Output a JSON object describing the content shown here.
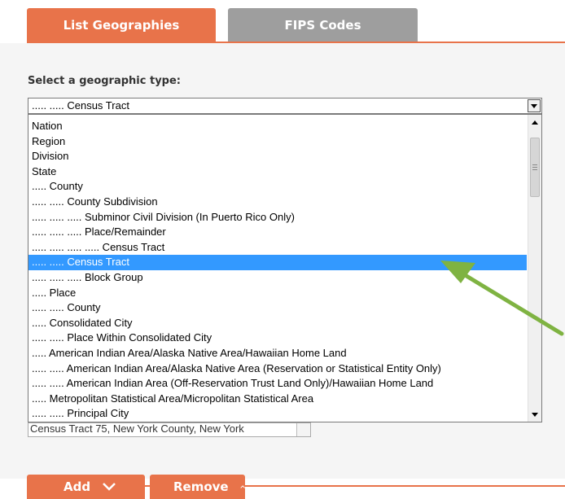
{
  "tabs": [
    {
      "label": "List Geographies",
      "active": true
    },
    {
      "label": "FIPS Codes",
      "active": false
    }
  ],
  "form": {
    "select_label": "Select a geographic type:",
    "selected_value": "..... ..... Census Tract",
    "options": [
      {
        "label": "Nation"
      },
      {
        "label": "Region"
      },
      {
        "label": "Division"
      },
      {
        "label": "State"
      },
      {
        "label": "..... County"
      },
      {
        "label": "..... ..... County Subdivision"
      },
      {
        "label": "..... ..... ..... Subminor Civil Division (In Puerto Rico Only)"
      },
      {
        "label": "..... ..... ..... Place/Remainder"
      },
      {
        "label": "..... ..... ..... ..... Census Tract"
      },
      {
        "label": "..... ..... Census Tract",
        "selected": true
      },
      {
        "label": "..... ..... ..... Block Group"
      },
      {
        "label": "..... Place"
      },
      {
        "label": "..... ..... County"
      },
      {
        "label": "..... Consolidated City"
      },
      {
        "label": "..... ..... Place Within Consolidated City"
      },
      {
        "label": "..... American Indian Area/Alaska Native Area/Hawaiian Home Land"
      },
      {
        "label": "..... ..... American Indian Area/Alaska Native Area (Reservation or Statistical Entity Only)"
      },
      {
        "label": "..... ..... American Indian Area (Off-Reservation Trust Land Only)/Hawaiian Home Land"
      },
      {
        "label": "..... Metropolitan Statistical Area/Micropolitan Statistical Area"
      },
      {
        "label": "..... ..... Principal City"
      }
    ],
    "scroll_position": 0.0,
    "background_select_value": "Census Tract 75, New York County, New York"
  },
  "actions": {
    "add_label": "Add",
    "remove_label": "Remove"
  },
  "colors": {
    "accent": "#e8734a",
    "inactive_tab": "#9e9e9e",
    "selection": "#3399ff",
    "annotation_arrow": "#7fb342"
  },
  "icons": {
    "add_chevron": "chevron-down-icon",
    "remove_chevron": "chevron-up-icon",
    "dropdown_arrow": "triangle-down-icon",
    "annotation": "arrow-icon"
  }
}
